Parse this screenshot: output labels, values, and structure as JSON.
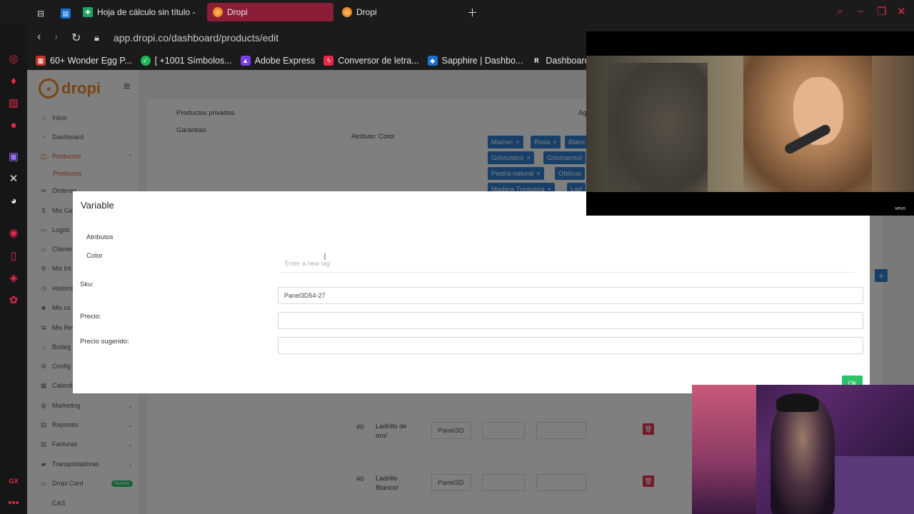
{
  "browser": {
    "tabs": [
      {
        "label": "Hoja de cálculo sin título -",
        "active": false
      },
      {
        "label": "Dropi",
        "active": true
      },
      {
        "label": "Dropi",
        "active": false
      }
    ],
    "url": "app.dropi.co/dashboard/products/edit",
    "bookmarks": [
      "60+ Wonder Egg P...",
      "[ +1001 Símbolos...",
      "Adobe Express",
      "Conversor de letra...",
      "Sapphire | Dashbo...",
      "Dashboard"
    ],
    "rail_label": "GX"
  },
  "sidebar": {
    "logo": "dropi",
    "items": [
      {
        "label": "Inicio",
        "icon": "home-icon"
      },
      {
        "label": "Dashboard",
        "icon": "dashboard-icon"
      },
      {
        "label": "Productos",
        "icon": "products-icon",
        "active": true
      },
      {
        "label": "Ordenes",
        "icon": "orders-icon"
      },
      {
        "label": "Mis Ga",
        "icon": "earnings-icon"
      },
      {
        "label": "Logist",
        "icon": "logistics-icon"
      },
      {
        "label": "Cliente",
        "icon": "clients-icon"
      },
      {
        "label": "Mis Int",
        "icon": "integrations-icon"
      },
      {
        "label": "Historia",
        "icon": "history-icon"
      },
      {
        "label": "Mis us",
        "icon": "users-icon"
      },
      {
        "label": "Mis Ret",
        "icon": "withdrawals-icon"
      },
      {
        "label": "Bodeg",
        "icon": "warehouse-icon"
      },
      {
        "label": "Config",
        "icon": "settings-icon"
      },
      {
        "label": "Calend",
        "icon": "calendar-icon"
      },
      {
        "label": "Marketing",
        "icon": "marketing-icon"
      },
      {
        "label": "Reportes",
        "icon": "reports-icon"
      },
      {
        "label": "Facturas",
        "icon": "invoices-icon"
      },
      {
        "label": "Transportadoras",
        "icon": "carriers-icon"
      },
      {
        "label": "Dropi Card",
        "icon": "card-icon",
        "badge": "Nuevo"
      },
      {
        "label": "CAS",
        "icon": "cas-icon"
      }
    ],
    "sub_item": "Productos"
  },
  "content": {
    "labels": [
      "Productos privados",
      "Garantías"
    ],
    "attribute_label": "Atributo: Color",
    "ag_fragment": "Ag",
    "chips": [
      "Marron",
      "Rosa",
      "Blanc",
      "Grisrustico",
      "Grismarmol",
      "Piedra natural",
      "Oblicuo",
      "Madera Turqueza",
      "Lad"
    ],
    "rows": [
      {
        "num": "#0",
        "name": "Ladrillo de oro/",
        "sku": "Panel3D"
      },
      {
        "num": "#0",
        "name": "Ladrillo Blanco/",
        "sku": "Panel3D"
      }
    ]
  },
  "modal": {
    "title": "Variable",
    "attributes_label": "Atributos",
    "color_label": "Color",
    "tag_placeholder": "Enter a new tag",
    "sku_label": "Sku:",
    "sku_value": "Panel3D54-27",
    "precio_label": "Precio:",
    "precio_value": "",
    "precio_sugerido_label": "Precio sugerido:",
    "precio_sugerido_value": "",
    "ok_label": "Ok"
  },
  "video": {
    "watermark": "vevo"
  },
  "colors": {
    "accent_orange": "#f08a24",
    "chip_blue": "#2f7fd1",
    "ok_green": "#2cc36b",
    "gx_red": "#e8294a",
    "active_tab": "#8c1d36"
  }
}
